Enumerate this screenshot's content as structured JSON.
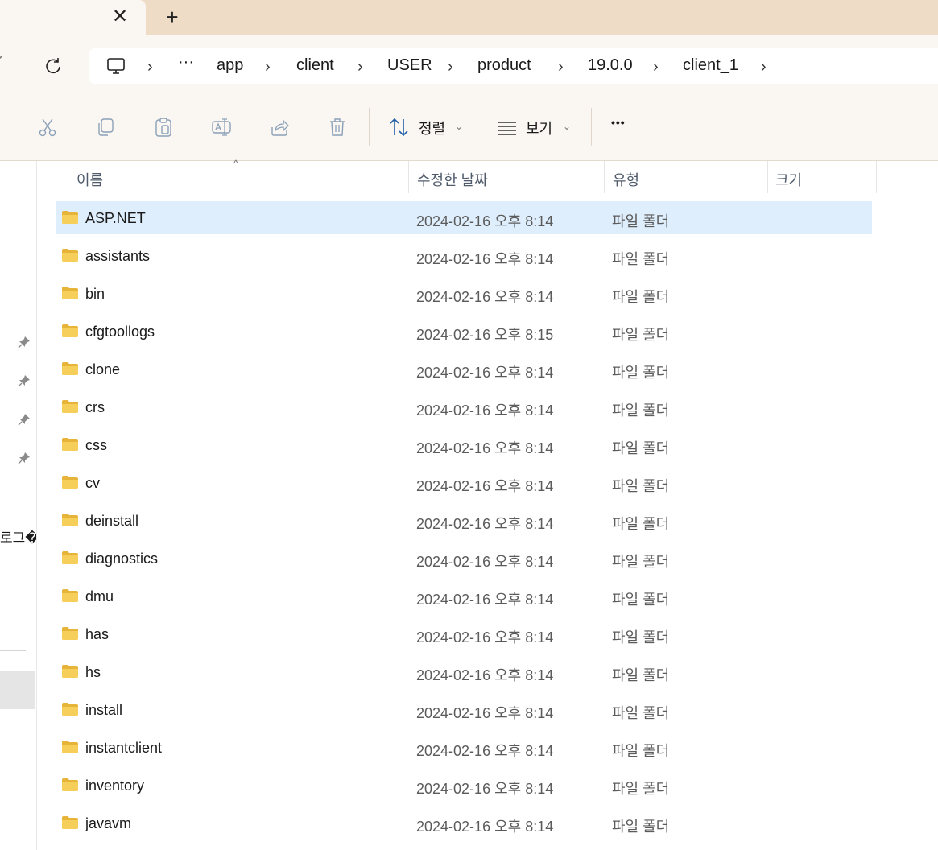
{
  "tabs": {
    "close_symbol": "✕",
    "new_symbol": "+"
  },
  "breadcrumb": {
    "ellipsis": "···",
    "segments": [
      "app",
      "client",
      "USER",
      "product",
      "19.0.0",
      "client_1"
    ],
    "separator": "›"
  },
  "toolbar": {
    "sort_label": "정렬",
    "view_label": "보기",
    "more_label": "•••",
    "caret": "⌄"
  },
  "leftpane": {
    "partial_text": "로그�"
  },
  "columns": {
    "name": "이름",
    "date": "수정한 날짜",
    "type": "유형",
    "size": "크기"
  },
  "sort_indicator": "^",
  "files": [
    {
      "name": "ASP.NET",
      "date": "2024-02-16 오후 8:14",
      "type": "파일 폴더"
    },
    {
      "name": "assistants",
      "date": "2024-02-16 오후 8:14",
      "type": "파일 폴더"
    },
    {
      "name": "bin",
      "date": "2024-02-16 오후 8:14",
      "type": "파일 폴더"
    },
    {
      "name": "cfgtoollogs",
      "date": "2024-02-16 오후 8:15",
      "type": "파일 폴더"
    },
    {
      "name": "clone",
      "date": "2024-02-16 오후 8:14",
      "type": "파일 폴더"
    },
    {
      "name": "crs",
      "date": "2024-02-16 오후 8:14",
      "type": "파일 폴더"
    },
    {
      "name": "css",
      "date": "2024-02-16 오후 8:14",
      "type": "파일 폴더"
    },
    {
      "name": "cv",
      "date": "2024-02-16 오후 8:14",
      "type": "파일 폴더"
    },
    {
      "name": "deinstall",
      "date": "2024-02-16 오후 8:14",
      "type": "파일 폴더"
    },
    {
      "name": "diagnostics",
      "date": "2024-02-16 오후 8:14",
      "type": "파일 폴더"
    },
    {
      "name": "dmu",
      "date": "2024-02-16 오후 8:14",
      "type": "파일 폴더"
    },
    {
      "name": "has",
      "date": "2024-02-16 오후 8:14",
      "type": "파일 폴더"
    },
    {
      "name": "hs",
      "date": "2024-02-16 오후 8:14",
      "type": "파일 폴더"
    },
    {
      "name": "install",
      "date": "2024-02-16 오후 8:14",
      "type": "파일 폴더"
    },
    {
      "name": "instantclient",
      "date": "2024-02-16 오후 8:14",
      "type": "파일 폴더"
    },
    {
      "name": "inventory",
      "date": "2024-02-16 오후 8:14",
      "type": "파일 폴더"
    },
    {
      "name": "javavm",
      "date": "2024-02-16 오후 8:14",
      "type": "파일 폴더"
    }
  ],
  "selected_index": 0,
  "colors": {
    "accent_selected": "#dfeefc",
    "tab_strip": "#efdcc6",
    "folder": "#f2c94c"
  }
}
